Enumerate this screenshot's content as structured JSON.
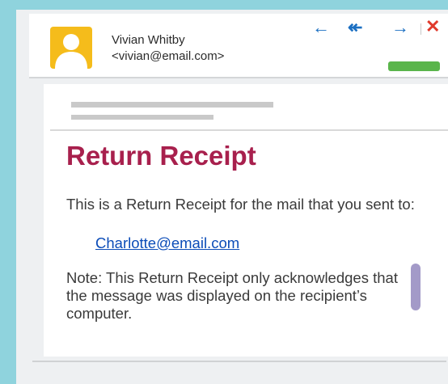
{
  "header": {
    "sender_name": "Vivian Whitby",
    "sender_email": "<vivian@email.com>",
    "avatar_color": "#f5bc1b",
    "nav": {
      "reply": "←",
      "reply_all": "↞",
      "forward": "→",
      "close": "✕"
    },
    "status_color": "#5ab54b"
  },
  "message": {
    "title": "Return Receipt",
    "title_color": "#a8204d",
    "intro": "This is a Return Receipt for the mail that you sent to:",
    "recipient": "Charlotte@email.com",
    "note": "Note: This Return Receipt only acknowledges that the message was displayed on the recipient’s computer."
  },
  "colors": {
    "background": "#8fd3dd",
    "link": "#0b4cb8",
    "nav_icons": "#1b6fc2",
    "close_icon": "#e0392b",
    "scrollbar": "#a39ac8"
  }
}
